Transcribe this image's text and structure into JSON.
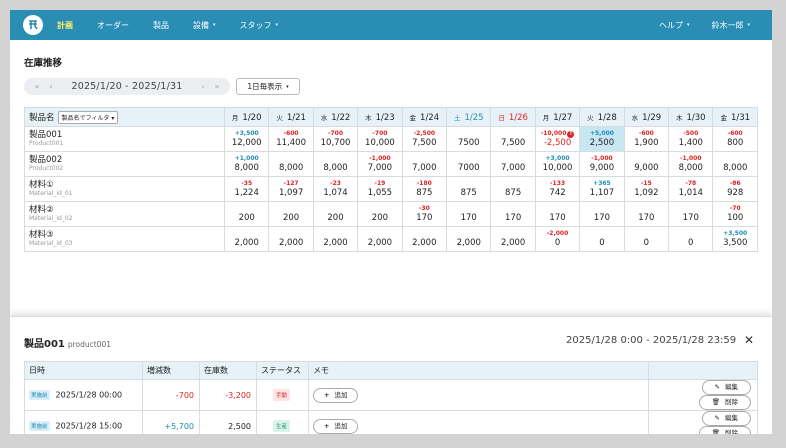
{
  "nav": {
    "items": [
      "計画",
      "オーダー",
      "製品",
      "設備",
      "スタッフ"
    ],
    "help": "ヘルプ",
    "user": "鈴木一郎",
    "caret": "▾"
  },
  "page": {
    "title": "在庫推移"
  },
  "datebar": {
    "first": "«",
    "prev": "‹",
    "range": "2025/1/20 - 2025/1/31",
    "next": "›",
    "last": "»"
  },
  "interval": {
    "label": "1日毎表示",
    "caret": "▾"
  },
  "inventory": {
    "name_header": "製品名",
    "filter_label": "製品名でフィルタ",
    "filter_caret": "▾",
    "days": [
      {
        "wd": "月",
        "date": "1/20",
        "type": ""
      },
      {
        "wd": "火",
        "date": "1/21",
        "type": ""
      },
      {
        "wd": "水",
        "date": "1/22",
        "type": ""
      },
      {
        "wd": "木",
        "date": "1/23",
        "type": ""
      },
      {
        "wd": "金",
        "date": "1/24",
        "type": ""
      },
      {
        "wd": "土",
        "date": "1/25",
        "type": "sat"
      },
      {
        "wd": "日",
        "date": "1/26",
        "type": "sun"
      },
      {
        "wd": "月",
        "date": "1/27",
        "type": ""
      },
      {
        "wd": "火",
        "date": "1/28",
        "type": ""
      },
      {
        "wd": "水",
        "date": "1/29",
        "type": ""
      },
      {
        "wd": "木",
        "date": "1/30",
        "type": ""
      },
      {
        "wd": "金",
        "date": "1/31",
        "type": ""
      }
    ],
    "rows": [
      {
        "name": "製品001",
        "code": "Product001",
        "cells": [
          {
            "d": "+3,500",
            "v": "12,000"
          },
          {
            "d": "-600",
            "v": "11,400"
          },
          {
            "d": "-700",
            "v": "10,700"
          },
          {
            "d": "-700",
            "v": "10,000"
          },
          {
            "d": "-2,500",
            "v": "7,500"
          },
          {
            "d": "",
            "v": "7500"
          },
          {
            "d": "",
            "v": "7,500"
          },
          {
            "d": "-10,000",
            "v": "-2,500",
            "alert": "!",
            "vneg": true
          },
          {
            "d": "+5,000",
            "v": "2,500",
            "hl": true
          },
          {
            "d": "-600",
            "v": "1,900"
          },
          {
            "d": "-500",
            "v": "1,400"
          },
          {
            "d": "-600",
            "v": "800"
          }
        ]
      },
      {
        "name": "製品002",
        "code": "Product002",
        "cells": [
          {
            "d": "+1,000",
            "v": "8,000"
          },
          {
            "d": "",
            "v": "8,000"
          },
          {
            "d": "",
            "v": "8,000"
          },
          {
            "d": "-1,000",
            "v": "7,000"
          },
          {
            "d": "",
            "v": "7,000"
          },
          {
            "d": "",
            "v": "7000"
          },
          {
            "d": "",
            "v": "7,000"
          },
          {
            "d": "+3,000",
            "v": "10,000"
          },
          {
            "d": "-1,000",
            "v": "9,000"
          },
          {
            "d": "",
            "v": "9,000"
          },
          {
            "d": "-1,000",
            "v": "8,000"
          },
          {
            "d": "",
            "v": "8,000"
          }
        ]
      },
      {
        "name": "材料①",
        "code": "Material_id_01",
        "cells": [
          {
            "d": "-35",
            "v": "1,224"
          },
          {
            "d": "-127",
            "v": "1,097"
          },
          {
            "d": "-23",
            "v": "1,074"
          },
          {
            "d": "-19",
            "v": "1,055"
          },
          {
            "d": "-180",
            "v": "875"
          },
          {
            "d": "",
            "v": "875"
          },
          {
            "d": "",
            "v": "875"
          },
          {
            "d": "-133",
            "v": "742"
          },
          {
            "d": "+365",
            "v": "1,107"
          },
          {
            "d": "-15",
            "v": "1,092"
          },
          {
            "d": "-78",
            "v": "1,014"
          },
          {
            "d": "-86",
            "v": "928"
          }
        ]
      },
      {
        "name": "材料②",
        "code": "Material_id_02",
        "cells": [
          {
            "d": "",
            "v": "200"
          },
          {
            "d": "",
            "v": "200"
          },
          {
            "d": "",
            "v": "200"
          },
          {
            "d": "",
            "v": "200"
          },
          {
            "d": "-30",
            "v": "170"
          },
          {
            "d": "",
            "v": "170"
          },
          {
            "d": "",
            "v": "170"
          },
          {
            "d": "",
            "v": "170"
          },
          {
            "d": "",
            "v": "170"
          },
          {
            "d": "",
            "v": "170"
          },
          {
            "d": "",
            "v": "170"
          },
          {
            "d": "-70",
            "v": "100"
          }
        ]
      },
      {
        "name": "材料③",
        "code": "Material_id_03",
        "cells": [
          {
            "d": "",
            "v": "2,000"
          },
          {
            "d": "",
            "v": "2,000"
          },
          {
            "d": "",
            "v": "2,000"
          },
          {
            "d": "",
            "v": "2,000"
          },
          {
            "d": "",
            "v": "2,000"
          },
          {
            "d": "",
            "v": "2,000"
          },
          {
            "d": "",
            "v": "2,000"
          },
          {
            "d": "-2,000",
            "v": "0"
          },
          {
            "d": "",
            "v": "0"
          },
          {
            "d": "",
            "v": "0"
          },
          {
            "d": "",
            "v": "0"
          },
          {
            "d": "+3,500",
            "v": "3,500"
          }
        ]
      }
    ]
  },
  "detail": {
    "title": "製品001",
    "code": "product001",
    "range": "2025/1/28 0:00 - 2025/1/28 23:59",
    "close": "✕",
    "headers": [
      "日時",
      "増減数",
      "在庫数",
      "ステータス",
      "メモ"
    ],
    "rows": [
      {
        "tag": "実施前",
        "datetime": "2025/1/28 00:00",
        "delta": "-700",
        "stock": "-3,200",
        "status": "手動",
        "status_type": "manual"
      },
      {
        "tag": "実施前",
        "datetime": "2025/1/28 15:00",
        "delta": "+5,700",
        "stock": "2,500",
        "status": "生産",
        "status_type": "prod"
      }
    ],
    "add_label": "追加",
    "edit_label": "編集",
    "delete_label": "削除"
  },
  "colors": {
    "nav": "#2a8db3",
    "negative": "#e02222",
    "positive": "#1f8ab0",
    "highlight": "#c9e6f3"
  }
}
